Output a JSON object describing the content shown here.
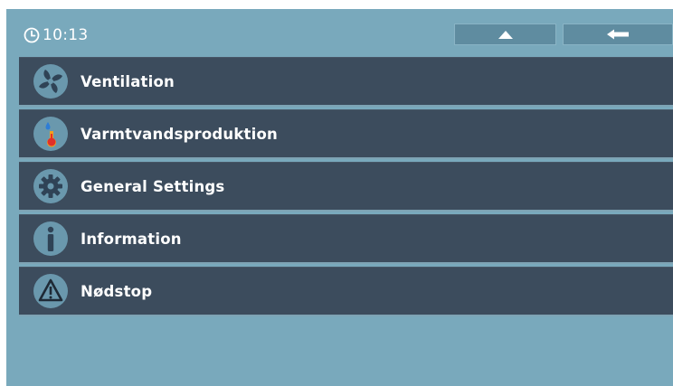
{
  "status_bar": {
    "time": "10:13",
    "clock_icon": "clock-icon",
    "home_icon": "home-icon",
    "back_icon": "back-arrow-icon"
  },
  "menu": {
    "items": [
      {
        "label": "Ventilation",
        "icon": "fan-icon"
      },
      {
        "label": "Varmtvandsproduktion",
        "icon": "water-temperature-icon"
      },
      {
        "label": "General Settings",
        "icon": "gear-icon"
      },
      {
        "label": "Information",
        "icon": "info-icon"
      },
      {
        "label": "Nødstop",
        "icon": "warning-icon"
      }
    ]
  },
  "colors": {
    "background": "#79a9bc",
    "row_background": "#3c4c5d",
    "icon_circle": "#6a98ad",
    "text": "#ffffff"
  }
}
